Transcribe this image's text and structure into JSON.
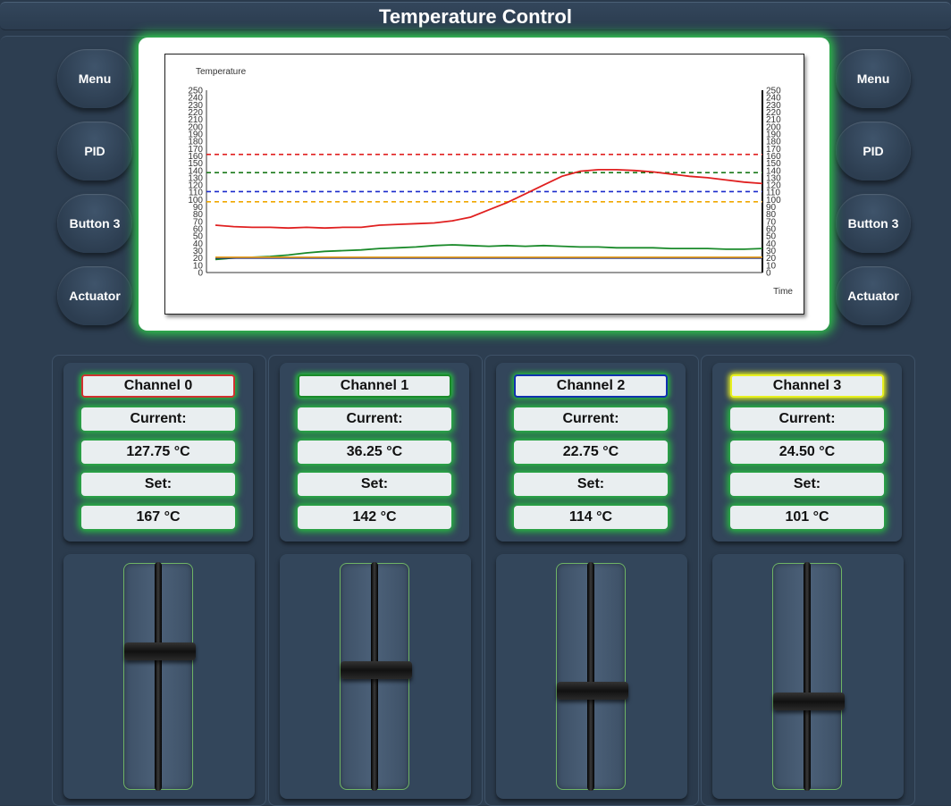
{
  "window": {
    "title": "Temperature Control"
  },
  "left_buttons": [
    "Menu",
    "PID",
    "Button 3",
    "Actuator"
  ],
  "right_buttons": [
    "Menu",
    "PID",
    "Button 3",
    "Actuator"
  ],
  "channels": [
    {
      "name": "Channel 0",
      "current_label": "Current:",
      "current_value": "127.75 °C",
      "set_label": "Set:",
      "set_value": "167 °C",
      "color": "#d03030",
      "slider_level": 0.62
    },
    {
      "name": "Channel 1",
      "current_label": "Current:",
      "current_value": "36.25 °C",
      "set_label": "Set:",
      "set_value": "142 °C",
      "color": "#1a8a2a",
      "slider_level": 0.53
    },
    {
      "name": "Channel 2",
      "current_label": "Current:",
      "current_value": "22.75 °C",
      "set_label": "Set:",
      "set_value": "114 °C",
      "color": "#1030b0",
      "slider_level": 0.43
    },
    {
      "name": "Channel 3",
      "current_label": "Current:",
      "current_value": "24.50 °C",
      "set_label": "Set:",
      "set_value": "101 °C",
      "color": "#e8f020",
      "slider_level": 0.38
    }
  ],
  "chart_data": {
    "type": "line",
    "ylabel": "Temperature",
    "xlabel": "Time",
    "ylim": [
      0,
      250
    ],
    "yticks": [
      0,
      10,
      20,
      30,
      40,
      50,
      60,
      70,
      80,
      90,
      100,
      110,
      120,
      130,
      140,
      150,
      160,
      170,
      180,
      190,
      200,
      210,
      220,
      230,
      240,
      250
    ],
    "x": [
      0,
      1,
      2,
      3,
      4,
      5,
      6,
      7,
      8,
      9,
      10,
      11,
      12,
      13,
      14,
      15,
      16,
      17,
      18,
      19,
      20,
      21,
      22,
      23,
      24,
      25,
      26,
      27,
      28,
      29,
      30
    ],
    "series": [
      {
        "color": "#e02020",
        "values": [
          65,
          63,
          62,
          62,
          61,
          62,
          61,
          62,
          62,
          65,
          66,
          67,
          68,
          71,
          76,
          86,
          96,
          108,
          120,
          132,
          139,
          141,
          141,
          140,
          138,
          135,
          132,
          130,
          127,
          124,
          122
        ]
      },
      {
        "color": "#1a8a2a",
        "values": [
          18,
          20,
          21,
          22,
          24,
          27,
          29,
          30,
          31,
          33,
          34,
          35,
          37,
          38,
          37,
          36,
          37,
          36,
          37,
          36,
          35,
          35,
          34,
          34,
          34,
          33,
          33,
          33,
          32,
          32,
          33
        ]
      },
      {
        "color": "#102080",
        "values": [
          20,
          20,
          20,
          20,
          20,
          20,
          20,
          20,
          20,
          20,
          20,
          20,
          20,
          20,
          20,
          20,
          20,
          20,
          20,
          20,
          20,
          20,
          20,
          20,
          20,
          20,
          20,
          20,
          20,
          20,
          20
        ]
      },
      {
        "color": "#e8a020",
        "values": [
          21,
          21,
          21,
          21,
          21,
          21,
          21,
          21,
          21,
          21,
          21,
          21,
          21,
          21,
          21,
          21,
          21,
          21,
          21,
          21,
          21,
          21,
          21,
          21,
          21,
          21,
          21,
          21,
          21,
          21,
          21
        ]
      }
    ],
    "setpoints": [
      {
        "value": 162,
        "color": "#e02020"
      },
      {
        "value": 137,
        "color": "#1a7a1a"
      },
      {
        "value": 111,
        "color": "#1a2acc"
      },
      {
        "value": 97,
        "color": "#f0a800"
      }
    ]
  }
}
